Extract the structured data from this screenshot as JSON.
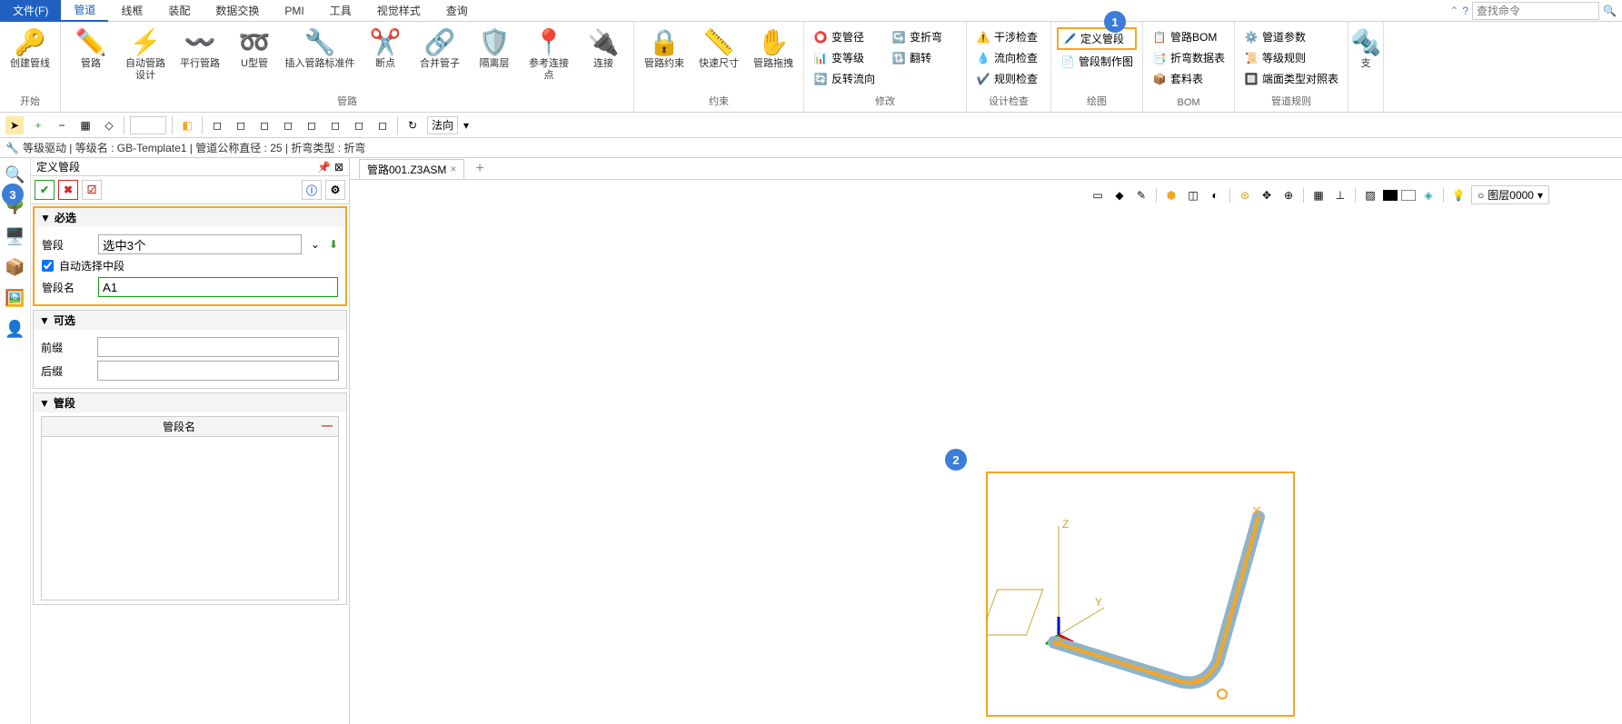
{
  "menu": {
    "file": "文件(F)",
    "tabs": [
      "管道",
      "线框",
      "装配",
      "数据交换",
      "PMI",
      "工具",
      "视觉样式",
      "查询"
    ],
    "active_tab": "管道",
    "search_placeholder": "查找命令"
  },
  "ribbon": {
    "start": {
      "label": "开始",
      "btn_create": "创建管线"
    },
    "route": {
      "label": "管路",
      "buttons": [
        "管路",
        "自动管路设计",
        "平行管路",
        "U型管",
        "插入管路标准件",
        "断点",
        "合并管子",
        "隔离层",
        "参考连接点",
        "连接"
      ]
    },
    "constraint": {
      "label": "约束",
      "buttons": [
        "管路约束",
        "快速尺寸",
        "管路拖拽"
      ]
    },
    "modify": {
      "label": "修改",
      "items": [
        "变管径",
        "变等级",
        "反转流向",
        "变折弯",
        "翻转"
      ]
    },
    "check": {
      "label": "设计检查",
      "items": [
        "干涉检查",
        "流向检查",
        "规则检查"
      ]
    },
    "draw": {
      "label": "绘图",
      "items": [
        "定义管段",
        "管段制作图"
      ]
    },
    "bom": {
      "label": "BOM",
      "items": [
        "管路BOM",
        "折弯数据表",
        "套料表"
      ]
    },
    "rules": {
      "label": "管道规则",
      "items": [
        "管道参数",
        "等级规则",
        "端面类型对照表"
      ]
    },
    "support": "支"
  },
  "quickbar": {
    "normal_label": "法向"
  },
  "status": "等级驱动 | 等级名 : GB-Template1 | 管道公称直径 : 25 | 折弯类型 : 折弯",
  "panel": {
    "title": "定义管段",
    "section_required": "必选",
    "row_pipe": "管段",
    "pipe_value": "选中3个",
    "auto_select": "自动选择中段",
    "row_name": "管段名",
    "name_value": "A1",
    "section_optional": "可选",
    "row_prefix": "前缀",
    "row_suffix": "后缀",
    "section_list": "管段",
    "col_name": "管段名"
  },
  "tab": {
    "name": "管路001.Z3ASM"
  },
  "layer": {
    "label": "图层0000"
  },
  "callouts": {
    "c1": "1",
    "c2": "2",
    "c3": "3"
  }
}
